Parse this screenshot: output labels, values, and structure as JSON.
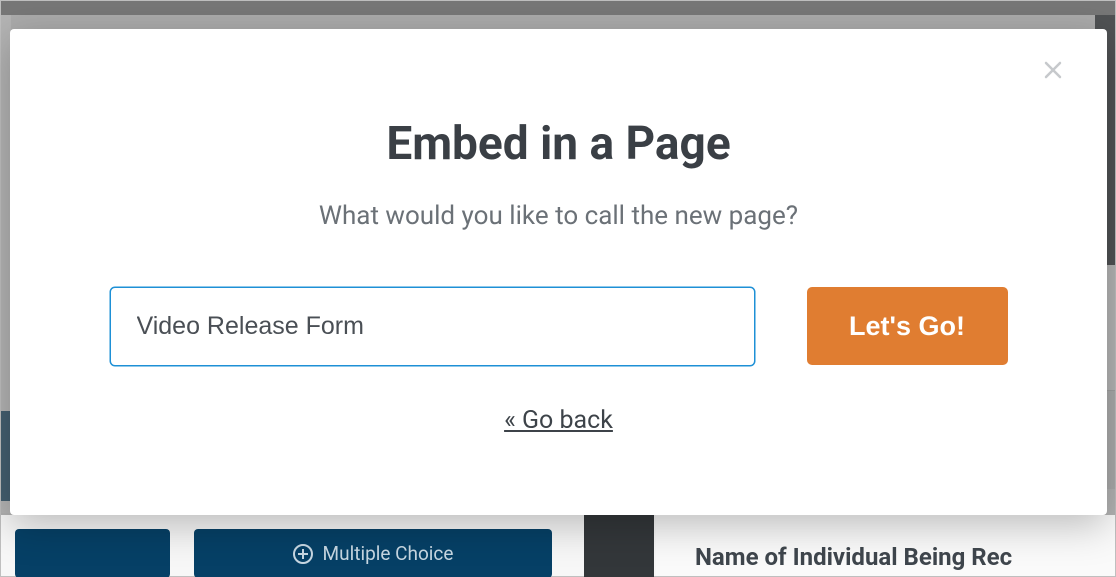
{
  "modal": {
    "title": "Embed in a Page",
    "subtitle": "What would you like to call the new page?",
    "page_name_value": "Video Release Form",
    "go_label": "Let's Go!",
    "back_label": "« Go back"
  },
  "background": {
    "multiple_choice_label": "Multiple Choice",
    "form_field_label": "Name of Individual Being Rec"
  },
  "colors": {
    "accent_orange": "#e07d31",
    "input_border": "#1e90d6",
    "bg_blue": "#064066"
  }
}
